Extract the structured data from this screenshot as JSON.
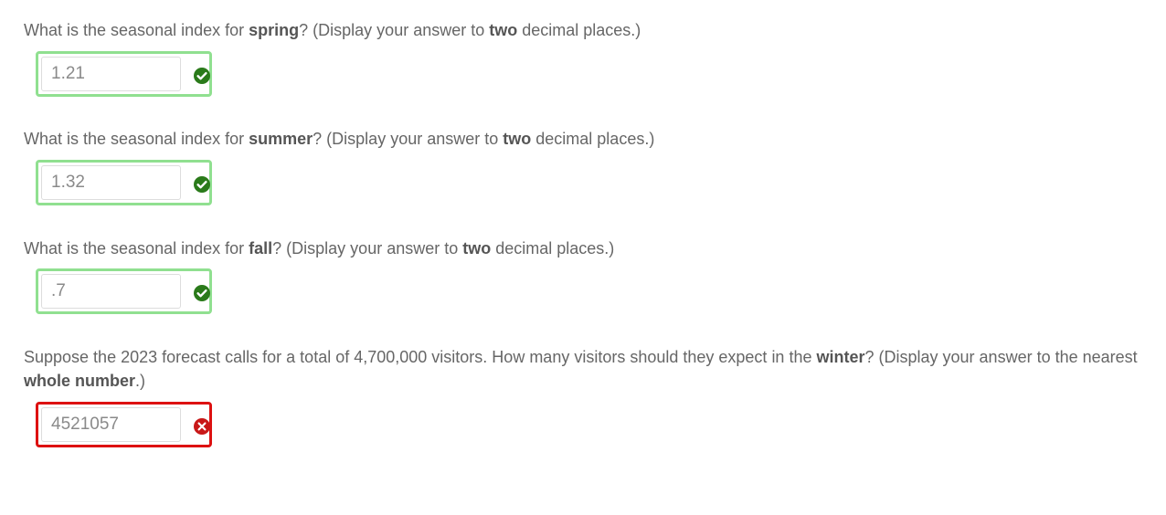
{
  "questions": [
    {
      "pre": "What is the seasonal index for ",
      "bold1": "spring",
      "mid": "? (Display your answer to ",
      "bold2": "two",
      "post": " decimal places.)",
      "answer": "1.21",
      "status": "correct"
    },
    {
      "pre": "What is the seasonal index for ",
      "bold1": "summer",
      "mid": "? (Display your answer to ",
      "bold2": "two",
      "post": " decimal places.)",
      "answer": "1.32",
      "status": "correct"
    },
    {
      "pre": "What is the seasonal index for ",
      "bold1": "fall",
      "mid": "? (Display your answer to ",
      "bold2": "two",
      "post": " decimal places.)",
      "answer": ".7",
      "status": "correct"
    },
    {
      "pre": "Suppose the 2023 forecast calls for a total of 4,700,000 visitors. How many visitors should they expect in the ",
      "bold1": "winter",
      "mid": "? (Display your answer to the nearest ",
      "bold2": "whole number",
      "post": ".)",
      "answer": "4521057",
      "status": "incorrect"
    }
  ],
  "colors": {
    "correct_border": "#90e090",
    "correct_icon": "#2a8a2a",
    "incorrect_border": "#dd1111",
    "incorrect_icon": "#cc1a1a"
  },
  "icons": {
    "correct": "check-circle-icon",
    "incorrect": "x-circle-icon"
  }
}
